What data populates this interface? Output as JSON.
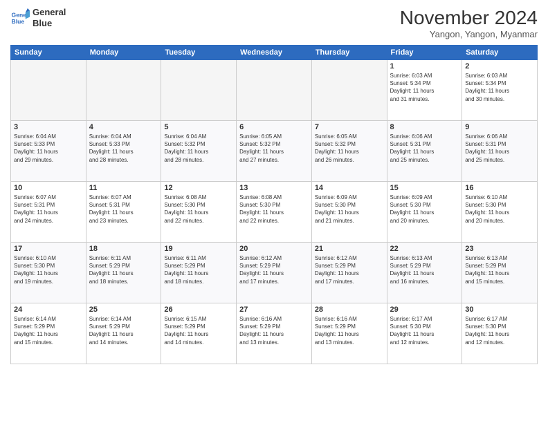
{
  "logo": {
    "line1": "General",
    "line2": "Blue"
  },
  "title": "November 2024",
  "location": "Yangon, Yangon, Myanmar",
  "weekdays": [
    "Sunday",
    "Monday",
    "Tuesday",
    "Wednesday",
    "Thursday",
    "Friday",
    "Saturday"
  ],
  "weeks": [
    [
      {
        "day": "",
        "info": ""
      },
      {
        "day": "",
        "info": ""
      },
      {
        "day": "",
        "info": ""
      },
      {
        "day": "",
        "info": ""
      },
      {
        "day": "",
        "info": ""
      },
      {
        "day": "1",
        "info": "Sunrise: 6:03 AM\nSunset: 5:34 PM\nDaylight: 11 hours\nand 31 minutes."
      },
      {
        "day": "2",
        "info": "Sunrise: 6:03 AM\nSunset: 5:34 PM\nDaylight: 11 hours\nand 30 minutes."
      }
    ],
    [
      {
        "day": "3",
        "info": "Sunrise: 6:04 AM\nSunset: 5:33 PM\nDaylight: 11 hours\nand 29 minutes."
      },
      {
        "day": "4",
        "info": "Sunrise: 6:04 AM\nSunset: 5:33 PM\nDaylight: 11 hours\nand 28 minutes."
      },
      {
        "day": "5",
        "info": "Sunrise: 6:04 AM\nSunset: 5:32 PM\nDaylight: 11 hours\nand 28 minutes."
      },
      {
        "day": "6",
        "info": "Sunrise: 6:05 AM\nSunset: 5:32 PM\nDaylight: 11 hours\nand 27 minutes."
      },
      {
        "day": "7",
        "info": "Sunrise: 6:05 AM\nSunset: 5:32 PM\nDaylight: 11 hours\nand 26 minutes."
      },
      {
        "day": "8",
        "info": "Sunrise: 6:06 AM\nSunset: 5:31 PM\nDaylight: 11 hours\nand 25 minutes."
      },
      {
        "day": "9",
        "info": "Sunrise: 6:06 AM\nSunset: 5:31 PM\nDaylight: 11 hours\nand 25 minutes."
      }
    ],
    [
      {
        "day": "10",
        "info": "Sunrise: 6:07 AM\nSunset: 5:31 PM\nDaylight: 11 hours\nand 24 minutes."
      },
      {
        "day": "11",
        "info": "Sunrise: 6:07 AM\nSunset: 5:31 PM\nDaylight: 11 hours\nand 23 minutes."
      },
      {
        "day": "12",
        "info": "Sunrise: 6:08 AM\nSunset: 5:30 PM\nDaylight: 11 hours\nand 22 minutes."
      },
      {
        "day": "13",
        "info": "Sunrise: 6:08 AM\nSunset: 5:30 PM\nDaylight: 11 hours\nand 22 minutes."
      },
      {
        "day": "14",
        "info": "Sunrise: 6:09 AM\nSunset: 5:30 PM\nDaylight: 11 hours\nand 21 minutes."
      },
      {
        "day": "15",
        "info": "Sunrise: 6:09 AM\nSunset: 5:30 PM\nDaylight: 11 hours\nand 20 minutes."
      },
      {
        "day": "16",
        "info": "Sunrise: 6:10 AM\nSunset: 5:30 PM\nDaylight: 11 hours\nand 20 minutes."
      }
    ],
    [
      {
        "day": "17",
        "info": "Sunrise: 6:10 AM\nSunset: 5:30 PM\nDaylight: 11 hours\nand 19 minutes."
      },
      {
        "day": "18",
        "info": "Sunrise: 6:11 AM\nSunset: 5:29 PM\nDaylight: 11 hours\nand 18 minutes."
      },
      {
        "day": "19",
        "info": "Sunrise: 6:11 AM\nSunset: 5:29 PM\nDaylight: 11 hours\nand 18 minutes."
      },
      {
        "day": "20",
        "info": "Sunrise: 6:12 AM\nSunset: 5:29 PM\nDaylight: 11 hours\nand 17 minutes."
      },
      {
        "day": "21",
        "info": "Sunrise: 6:12 AM\nSunset: 5:29 PM\nDaylight: 11 hours\nand 17 minutes."
      },
      {
        "day": "22",
        "info": "Sunrise: 6:13 AM\nSunset: 5:29 PM\nDaylight: 11 hours\nand 16 minutes."
      },
      {
        "day": "23",
        "info": "Sunrise: 6:13 AM\nSunset: 5:29 PM\nDaylight: 11 hours\nand 15 minutes."
      }
    ],
    [
      {
        "day": "24",
        "info": "Sunrise: 6:14 AM\nSunset: 5:29 PM\nDaylight: 11 hours\nand 15 minutes."
      },
      {
        "day": "25",
        "info": "Sunrise: 6:14 AM\nSunset: 5:29 PM\nDaylight: 11 hours\nand 14 minutes."
      },
      {
        "day": "26",
        "info": "Sunrise: 6:15 AM\nSunset: 5:29 PM\nDaylight: 11 hours\nand 14 minutes."
      },
      {
        "day": "27",
        "info": "Sunrise: 6:16 AM\nSunset: 5:29 PM\nDaylight: 11 hours\nand 13 minutes."
      },
      {
        "day": "28",
        "info": "Sunrise: 6:16 AM\nSunset: 5:29 PM\nDaylight: 11 hours\nand 13 minutes."
      },
      {
        "day": "29",
        "info": "Sunrise: 6:17 AM\nSunset: 5:30 PM\nDaylight: 11 hours\nand 12 minutes."
      },
      {
        "day": "30",
        "info": "Sunrise: 6:17 AM\nSunset: 5:30 PM\nDaylight: 11 hours\nand 12 minutes."
      }
    ]
  ]
}
